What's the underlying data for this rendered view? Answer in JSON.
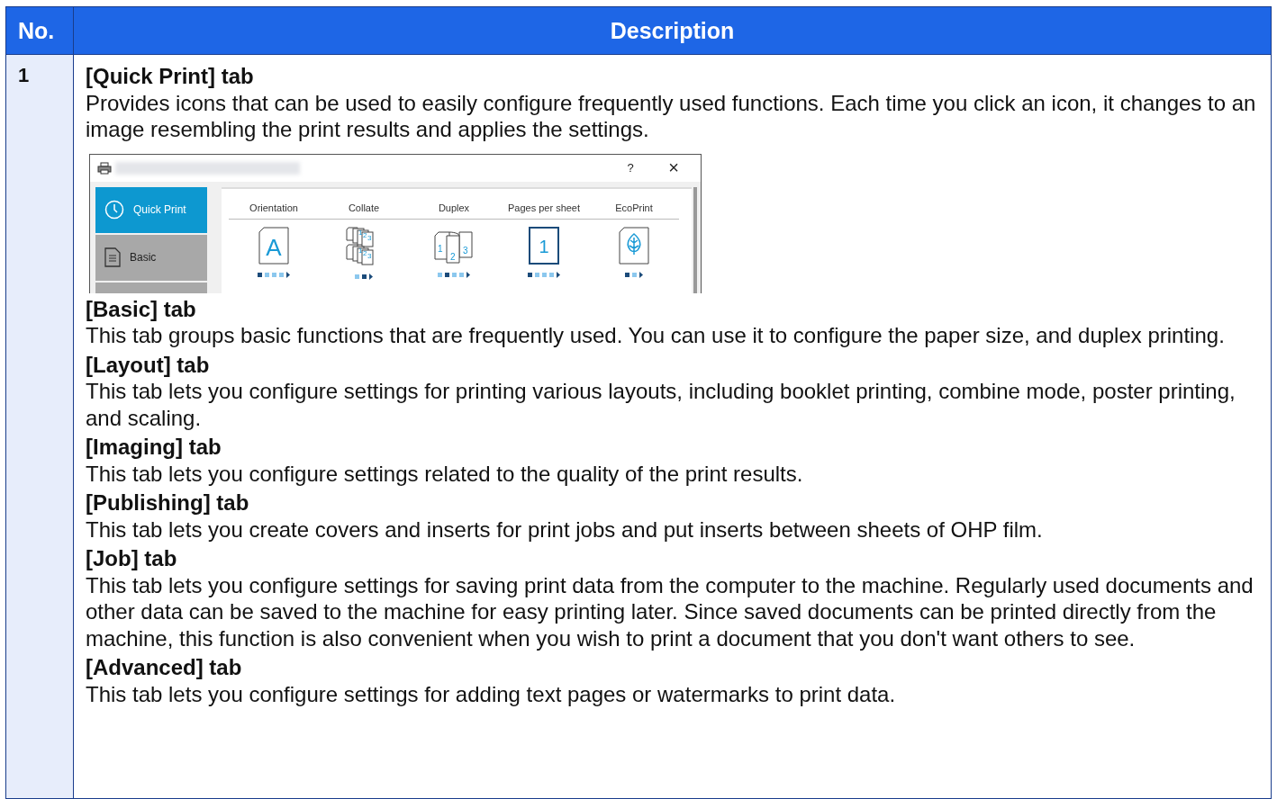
{
  "table": {
    "columns": [
      "No.",
      "Description"
    ],
    "rows": [
      {
        "number": "1",
        "sections": [
          {
            "title": "[Quick Print] tab",
            "text": "Provides icons that can be used to easily configure frequently used functions. Each time you click an icon, it changes to an image resembling the print results and applies the settings.",
            "screenshot": true
          },
          {
            "title": "[Basic] tab",
            "text": "This tab groups basic functions that are frequently used. You can use it to configure the paper size, and duplex printing."
          },
          {
            "title": "[Layout] tab",
            "text": "This tab lets you configure settings for printing various layouts, including booklet printing, combine mode, poster printing, and scaling."
          },
          {
            "title": "[Imaging] tab",
            "text": "This tab lets you configure settings related to the quality of the print results."
          },
          {
            "title": "[Publishing] tab",
            "text": "This tab lets you create covers and inserts for print jobs and put inserts between sheets of OHP film."
          },
          {
            "title": "[Job] tab",
            "text": "This tab lets you configure settings for saving print data from the computer to the machine. Regularly used documents and other data can be saved to the machine for easy printing later. Since saved documents can be printed directly from the machine, this function is also convenient when you wish to print a document that you don't want others to see."
          },
          {
            "title": "[Advanced] tab",
            "text": "This tab lets you configure settings for adding text pages or watermarks to print data."
          }
        ]
      }
    ]
  },
  "dialog": {
    "help": "?",
    "close": "×",
    "sidebar": [
      {
        "label": "Quick Print",
        "kind": "clock",
        "selected": true
      },
      {
        "label": "Basic",
        "kind": "document",
        "selected": false
      }
    ],
    "options": [
      {
        "label": "Orientation",
        "kind": "letter",
        "glyphs": [
          "A"
        ],
        "dots": [
          {
            "selected": true
          },
          {
            "selected": false
          },
          {
            "selected": false
          },
          {
            "selected": false
          }
        ]
      },
      {
        "label": "Collate",
        "kind": "collate",
        "glyphs": [
          "1",
          "2",
          "3",
          "1",
          "2",
          "3"
        ],
        "dots": [
          {
            "selected": false
          },
          {
            "selected": true
          }
        ]
      },
      {
        "label": "Duplex",
        "kind": "duplex",
        "glyphs": [
          "1",
          "2",
          "3"
        ],
        "dots": [
          {
            "selected": false
          },
          {
            "selected": true
          },
          {
            "selected": false
          },
          {
            "selected": false
          }
        ]
      },
      {
        "label": "Pages per sheet",
        "kind": "pages",
        "glyphs": [
          "1"
        ],
        "dots": [
          {
            "selected": true
          },
          {
            "selected": false
          },
          {
            "selected": false
          },
          {
            "selected": false
          }
        ]
      },
      {
        "label": "EcoPrint",
        "kind": "leaf",
        "dots": [
          {
            "selected": true
          },
          {
            "selected": false
          }
        ]
      }
    ]
  }
}
